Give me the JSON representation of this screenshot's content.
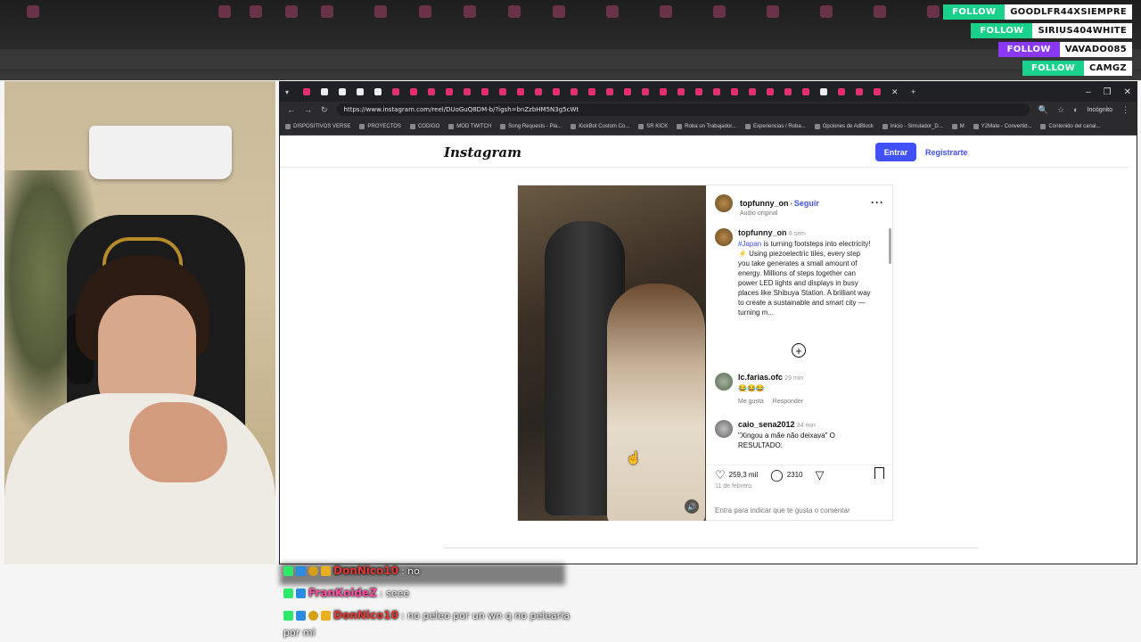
{
  "overlay": {
    "follows": [
      {
        "button": "FOLLOW",
        "name": "GOODLFR44XSIEMPRE",
        "color": "#19d18a"
      },
      {
        "button": "FOLLOW",
        "name": "SIRIUS404WHITE",
        "color": "#19d18a"
      },
      {
        "button": "FOLLOW",
        "name": "VAVADO085",
        "color": "#8a38f5"
      },
      {
        "button": "FOLLOW",
        "name": "CAMGZ",
        "color": "#19d18a"
      }
    ]
  },
  "browser": {
    "url": "https://www.instagram.com/reel/DUoGuQ8DM-b/?igsh=bnZzbHM5N3g5cWt",
    "mode": "Incógnito",
    "bookmarks": [
      "DISPOSITIVOS VERSE",
      "PROYECTOS",
      "CODIGO",
      "MOD TWITCH",
      "Song Requests - Pla...",
      "KickBot Custom Co...",
      "SR KICK",
      "Roba un Trabajador...",
      "Experiencias / Roba...",
      "Opciones de AdBlock",
      "Inicio - Simulador_D...",
      "M",
      "Y2Mate - Convertid...",
      "Contenido del canal..."
    ]
  },
  "instagram": {
    "logo": "Instagram",
    "login_button": "Entrar",
    "register_link": "Registrarte",
    "post": {
      "username": "topfunny_on",
      "follow": "Seguir",
      "separator": " • ",
      "audio": "Audio original",
      "caption_user": "topfunny_on",
      "caption_age": "8 sem",
      "hashtag": "#Japan",
      "caption": " is turning footsteps into electricity! ⚡ Using piezoelectric tiles, every step you take generates a small amount of energy. Millions of steps together can power LED lights and displays in busy places like Shibuya Station. A brilliant way to create a sustainable and smart city — turning m...",
      "comments": [
        {
          "user": "lc.farias.ofc",
          "age": "29 min",
          "text": "😂😂😂",
          "like": "Me gusta",
          "reply": "Responder"
        },
        {
          "user": "caio_sena2012",
          "age": "34 min",
          "text": "\"Xingou a mãe não deixava\" O RESULTADO:"
        }
      ],
      "likes": "259,3 mil",
      "comments_count": "2310",
      "date": "11 de febrero",
      "login_prompt": "Entra para indicar que te gusta o comentar"
    }
  },
  "chat": [
    {
      "user": "DonNico10",
      "user_color": "#e53935",
      "message": ": no"
    },
    {
      "user": "FranKoideZ",
      "user_color": "#ff4fa3",
      "message": ": seee"
    },
    {
      "user": "DonNico10",
      "user_color": "#e53935",
      "message": ": no peleo por un wn q no pelearia",
      "message2": "por mi"
    }
  ]
}
